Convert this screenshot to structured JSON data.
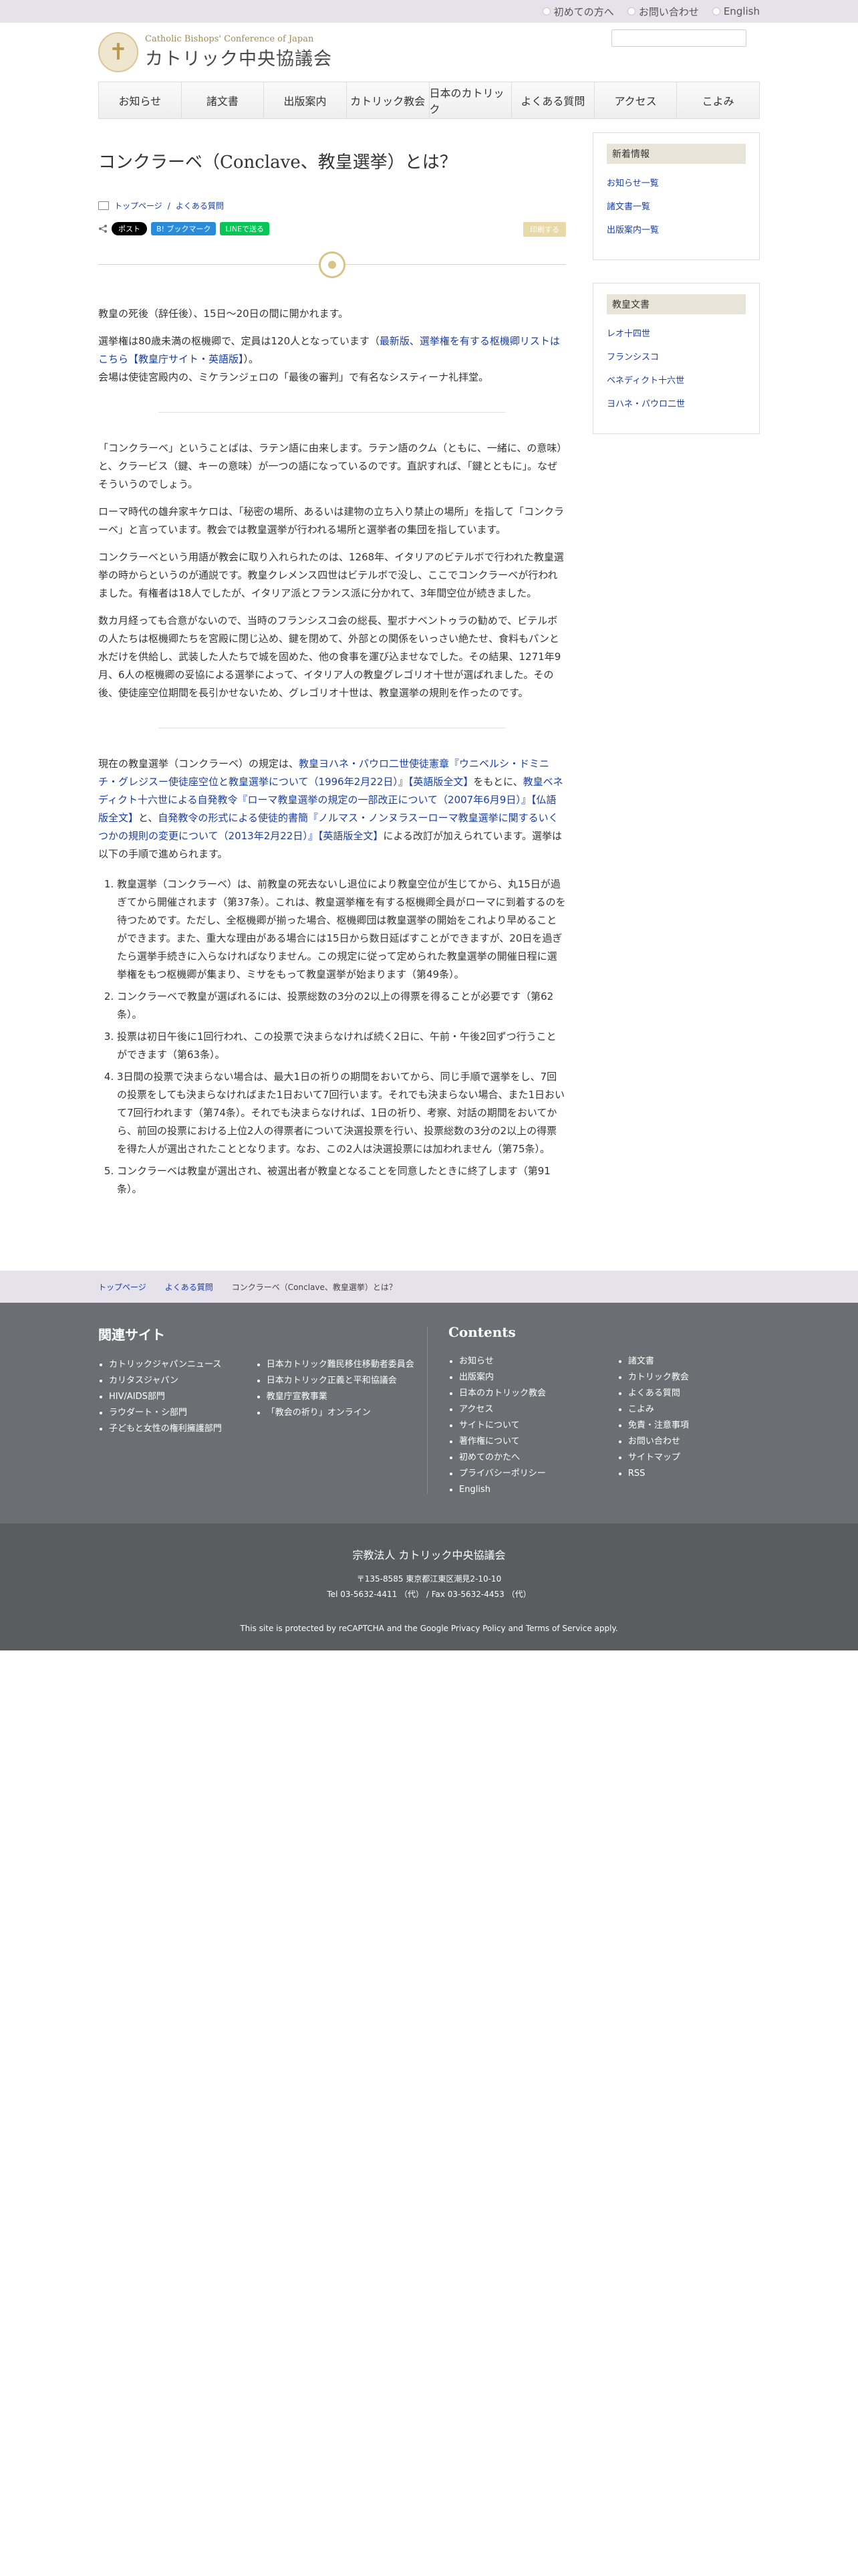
{
  "topbar": {
    "links": [
      "初めての方へ",
      "お問い合わせ",
      "English"
    ]
  },
  "header": {
    "logo_en": "Catholic Bishops' Conference of Japan",
    "logo_jp": "カトリック中央協議会"
  },
  "nav": [
    "お知らせ",
    "諸文書",
    "出版案内",
    "カトリック教会",
    "日本のカトリック",
    "よくある質問",
    "アクセス",
    "こよみ"
  ],
  "article": {
    "title": "コンクラーベ（Conclave、教皇選挙）とは？",
    "breadcrumb": [
      "トップページ",
      "よくある質問"
    ],
    "share": {
      "x": "ポスト",
      "hatena": "B! ブックマーク",
      "line": "LINEで送る",
      "print": "印刷する"
    },
    "intro1": "教皇の死後（辞任後）、15日〜20日の間に開かれます。",
    "intro2_a": "選挙権は80歳未満の枢機卿で、定員は120人となっています（",
    "intro2_link": "最新版、選挙権を有する枢機卿リストはこちら【教皇庁サイト・英語版】",
    "intro2_b": "）。",
    "intro3": "会場は使徒宮殿内の、ミケランジェロの「最後の審判」で有名なシスティーナ礼拝堂。",
    "para1": "「コンクラーベ」ということばは、ラテン語に由来します。ラテン語のクム（ともに、一緒に、の意味）と、クラービス（鍵、キーの意味）が一つの語になっているのです。直訳すれば、「鍵とともに」。なぜそういうのでしょう。",
    "para2": "ローマ時代の雄弁家キケロは、「秘密の場所、あるいは建物の立ち入り禁止の場所」を指して「コンクラーベ」と言っています。教会では教皇選挙が行われる場所と選挙者の集団を指しています。",
    "para3": "コンクラーベという用語が教会に取り入れられたのは、1268年、イタリアのビテルボで行われた教皇選挙の時からというのが通説です。教皇クレメンス四世はビテルボで没し、ここでコンクラーベが行われました。有権者は18人でしたが、イタリア派とフランス派に分かれて、3年間空位が続きました。",
    "para4": "数カ月経っても合意がないので、当時のフランシスコ会の総長、聖ボナベントゥラの勧めで、ビテルボの人たちは枢機卿たちを宮殿に閉じ込め、鍵を閉めて、外部との関係をいっさい絶たせ、食料もパンと水だけを供給し、武装した人たちで城を固めた、他の食事を運び込ませなでした。その結果、1271年9月、6人の枢機卿の妥協による選挙によって、イタリア人の教皇グレゴリオ十世が選ばれました。その後、使徒座空位期間を長引かせないため、グレゴリオ十世は、教皇選挙の規則を作ったのです。",
    "para5_a": "現在の教皇選挙（コンクラーベ）の規定は、",
    "para5_link1": "教皇ヨハネ・パウロ二世使徒憲章『ウニベルシ・ドミニチ・グレジスー使徒座空位と教皇選挙について（1996年2月22日）』【英語版全文】",
    "para5_b": "をもとに、",
    "para5_link2": "教皇ベネディクト十六世による自発教令『ローマ教皇選挙の規定の一部改正について（2007年6月9日）』【仏語版全文】",
    "para5_c": "と、",
    "para5_link3": "自発教令の形式による使徒的書簡『ノルマス・ノンヌラスーローマ教皇選挙に関するいくつかの規則の変更について（2013年2月22日）』【英語版全文】",
    "para5_d": "による改訂が加えられています。選挙は以下の手順で進められます。",
    "list": [
      "教皇選挙（コンクラーベ）は、前教皇の死去ないし退位により教皇空位が生じてから、丸15日が過ぎてから開催されます（第37条）。これは、教皇選挙権を有する枢機卿全員がローマに到着するのを待つためです。ただし、全枢機卿が揃った場合、枢機卿団は教皇選挙の開始をこれより早めることができます。また、重大な理由がある場合には15日から数日延ばすことができますが、20日を過ぎたら選挙手続きに入らなければなりません。この規定に従って定められた教皇選挙の開催日程に選挙権をもつ枢機卿が集まり、ミサをもって教皇選挙が始まります（第49条）。",
      "コンクラーベで教皇が選ばれるには、投票総数の3分の2以上の得票を得ることが必要です（第62条）。",
      "投票は初日午後に1回行われ、この投票で決まらなければ続く2日に、午前・午後2回ずつ行うことができます（第63条）。",
      "3日間の投票で決まらない場合は、最大1日の祈りの期間をおいてから、同じ手順で選挙をし、7回の投票をしても決まらなければまた1日おいて7回行います。それでも決まらない場合、また1日おいて7回行われます（第74条）。それでも決まらなければ、1日の祈り、考察、対話の期間をおいてから、前回の投票における上位2人の得票者について決選投票を行い、投票総数の3分の2以上の得票を得た人が選出されたこととなります。なお、この2人は決選投票には加われません（第75条）。",
      "コンクラーベは教皇が選出され、被選出者が教皇となることを同意したときに終了します（第91条）。"
    ]
  },
  "sidebar": {
    "box1_title": "新着情報",
    "box1_links": [
      "お知らせ一覧",
      "諸文書一覧",
      "出版案内一覧"
    ],
    "box2_title": "教皇文書",
    "box2_links": [
      "レオ十四世",
      "フランシスコ",
      "ベネディクト十六世",
      "ヨハネ・パウロ二世"
    ]
  },
  "footer_crumb": [
    "トップページ",
    "よくある質問",
    "コンクラーベ（Conclave、教皇選挙）とは？"
  ],
  "footer": {
    "related_title": "関連サイト",
    "related_col1": [
      "カトリックジャパンニュース",
      "カリタスジャパン",
      "HIV/AIDS部門",
      "ラウダート・シ部門",
      "子どもと女性の権利擁護部門"
    ],
    "related_col2": [
      "日本カトリック難民移住移動者委員会",
      "日本カトリック正義と平和協議会",
      "教皇庁宣教事業",
      "「教会の祈り」オンライン"
    ],
    "contents_title": "Contents",
    "contents_col1": [
      "お知らせ",
      "出版案内",
      "日本のカトリック教会",
      "アクセス",
      "サイトについて",
      "著作権について",
      "初めてのかたへ",
      "プライバシーポリシー",
      "English"
    ],
    "contents_col2": [
      "諸文書",
      "カトリック教会",
      "よくある質問",
      "こよみ",
      "免責・注意事項",
      "お問い合わせ",
      "サイトマップ",
      "RSS"
    ],
    "org_name": "宗教法人 カトリック中央協議会",
    "address": "〒135-8585 東京都江東区潮見2-10-10",
    "tel": "Tel 03-5632-4411 （代） / Fax 03-5632-4453 （代）",
    "recaptcha": "This site is protected by reCAPTCHA and the Google Privacy Policy and Terms of Service apply."
  }
}
